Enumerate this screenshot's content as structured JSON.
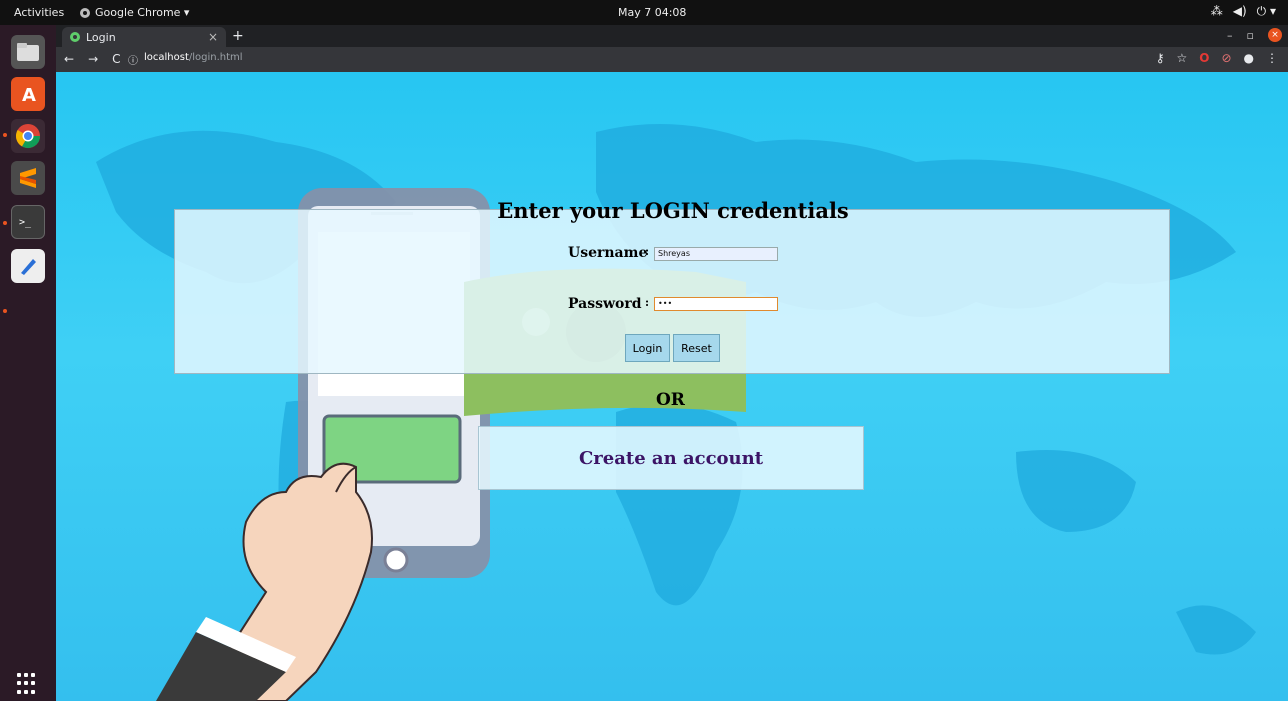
{
  "topbar": {
    "activities": "Activities",
    "app_name": "Google Chrome ▾",
    "clock": "May 7  04:08",
    "tray": [
      "⁂",
      "◀)",
      "⏻ ▾"
    ]
  },
  "browser": {
    "tab_title": "Login",
    "tab_close": "×",
    "new_tab": "+",
    "url_host": "localhost",
    "url_path": "/login.html",
    "win_min": "–",
    "win_max": "▫",
    "win_close": "×"
  },
  "page": {
    "heading": "Enter your LOGIN credentials",
    "username_label": "Username",
    "username_sep": ":",
    "username_value": "Shreyas",
    "password_label": "Password",
    "password_sep": ":",
    "password_value": "•••",
    "login_button": "Login",
    "reset_button": "Reset",
    "or_text": "OR",
    "create_account": "Create an account"
  },
  "colors": {
    "background": "#34c5f0",
    "accent": "#e95420",
    "link": "#3b1466"
  }
}
